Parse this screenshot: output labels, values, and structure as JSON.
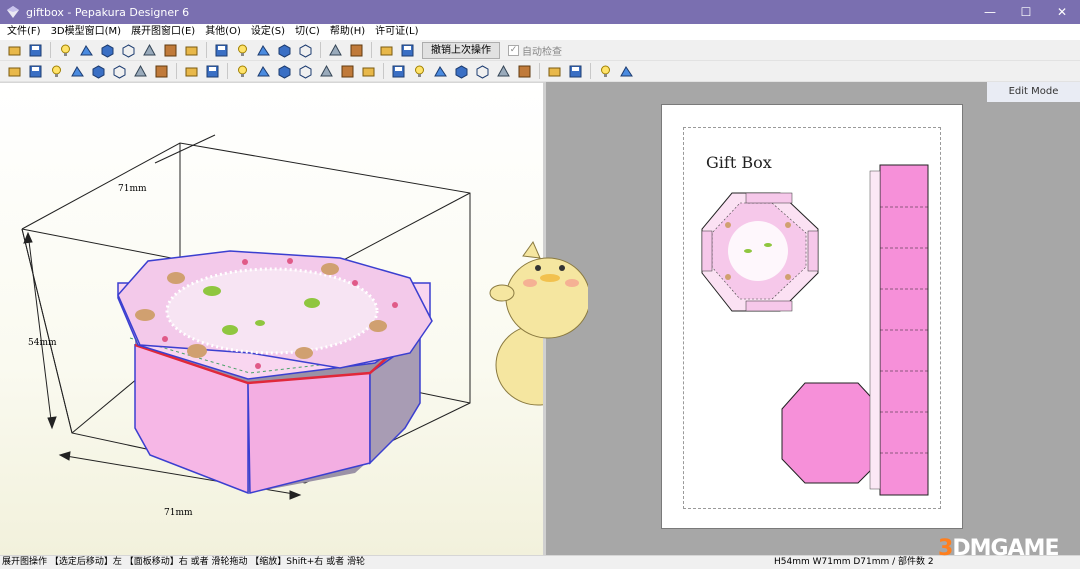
{
  "window": {
    "title": "giftbox - Pepakura Designer 6",
    "minimize": "—",
    "maximize": "☐",
    "close": "✕"
  },
  "menu": [
    "文件(F)",
    "3D模型窗口(M)",
    "展开图窗口(E)",
    "其他(O)",
    "设定(S)",
    "切(C)",
    "帮助(H)",
    "许可证(L)"
  ],
  "toolbar": {
    "undo_label": "撤销上次操作",
    "auto_check_label": "自动检查",
    "icons_row1": [
      "open-icon",
      "save-icon",
      "light-icon",
      "paint-icon",
      "solid-cube-icon",
      "wire-cube-icon",
      "normal-icon",
      "texture-icon",
      "explode-icon",
      "material-icon",
      "cylinder-icon",
      "axis-icon",
      "hierarchy-icon",
      "link-icon",
      "select-rect-icon",
      "move-icon",
      "window-split-icon",
      "window-single-icon"
    ],
    "icons_row2": [
      "select-icon",
      "rotate-icon",
      "grid-icon",
      "line-icon",
      "pen-icon",
      "text-icon",
      "image-icon",
      "box-icon",
      "undo-icon",
      "redo-icon",
      "flip-icon",
      "fold-icon",
      "arrange-icon",
      "page-icon",
      "page2-icon",
      "copy-icon",
      "print-icon",
      "align-left-icon",
      "align-bottom-icon",
      "align-top-icon",
      "align-center-icon",
      "align-middle-icon",
      "align-right-icon",
      "distribute-icon",
      "page-setup-icon",
      "page-setup2-icon",
      "fit-icon",
      "zoom-fit-icon"
    ]
  },
  "model_view": {
    "dim_top": "71mm",
    "dim_left": "54mm",
    "dim_bottom": "71mm"
  },
  "layout_view": {
    "mode_label": "Edit Mode",
    "sheet_title": "Gift Box"
  },
  "status": {
    "left": "展开图操作 【选定后移动】左 【面板移动】右 或者 滑轮拖动 【缩放】Shift+右 或者 滑轮",
    "right": "H54mm W71mm D71mm / 部件数 2"
  },
  "watermark": {
    "prefix": "3",
    "rest": "DMGAME"
  },
  "colors": {
    "titlebar": "#7a6fb0",
    "pink": "#f6a6e0",
    "lid": "#f3c9ea",
    "edge_red": "#e0283a",
    "edge_blue": "#3b3fd0"
  }
}
